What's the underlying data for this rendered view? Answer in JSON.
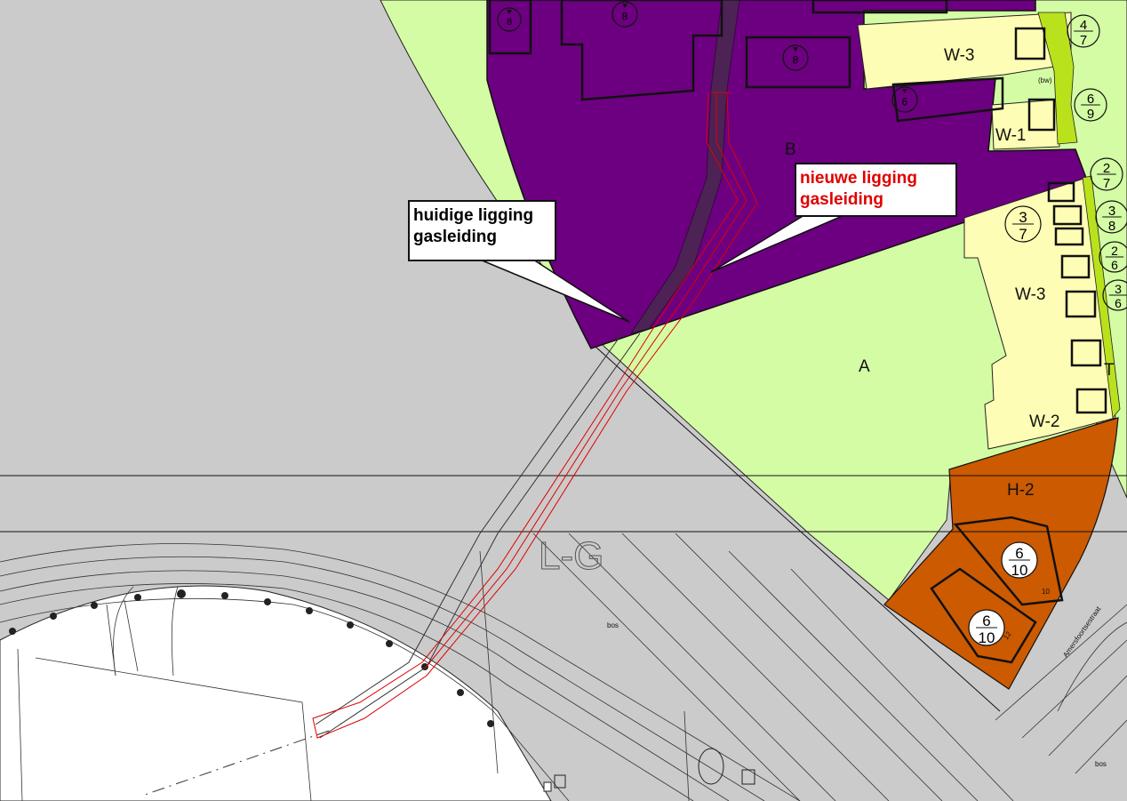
{
  "zones": {
    "a": "A",
    "b": "B",
    "w3_top": "W-3",
    "w1": "W-1",
    "w3_mid": "W-3",
    "w2": "W-2",
    "h2": "H-2",
    "t": "T"
  },
  "markers": [
    {
      "top": "8",
      "bottom": ""
    },
    {
      "top": "8",
      "bottom": ""
    },
    {
      "top": "8",
      "bottom": ""
    },
    {
      "top": "6",
      "bottom": ""
    },
    {
      "top": "4",
      "bottom": "7"
    },
    {
      "top": "6",
      "bottom": "9"
    },
    {
      "top": "2",
      "bottom": "7"
    },
    {
      "top": "3",
      "bottom": "7"
    },
    {
      "top": "3",
      "bottom": "8"
    },
    {
      "top": "2",
      "bottom": "6"
    },
    {
      "top": "3",
      "bottom": "6"
    },
    {
      "top": "6",
      "bottom": "10"
    },
    {
      "top": "6",
      "bottom": "10"
    }
  ],
  "small_labels": {
    "bw": "(bw)",
    "lg": "L-G",
    "bos_1": "bos",
    "bos_2": "bos",
    "street": "Amersfoortsestraat",
    "n10": "10",
    "n12": "12"
  },
  "callouts": {
    "current_line1": "huidige ligging",
    "current_line2": "gasleiding",
    "new_line1": "nieuwe ligging",
    "new_line2": "gasleiding"
  },
  "legend_colors": {
    "background": "#cbcbcb",
    "green_zone": "#d4fca4",
    "purple_zone": "#6c0080",
    "yellow_zone": "#fdfdb5",
    "lime_strip": "#b9e21c",
    "orange_zone": "#cc5a00",
    "new_pipeline": "#e00000",
    "current_pipeline": "#333333"
  }
}
